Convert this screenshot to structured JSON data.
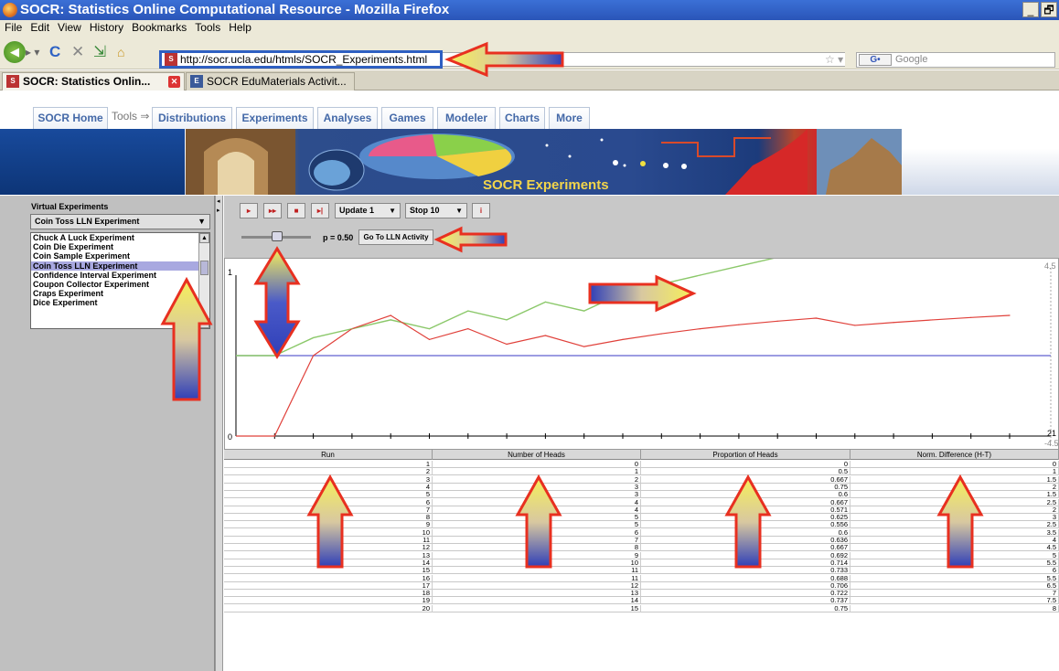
{
  "window": {
    "title": "SOCR: Statistics Online Computational Resource - Mozilla Firefox",
    "controls": [
      "_",
      "🗗"
    ]
  },
  "menu": [
    "File",
    "Edit",
    "View",
    "History",
    "Bookmarks",
    "Tools",
    "Help"
  ],
  "toolbar": {
    "url": "http://socr.ucla.edu/htmls/SOCR_Experiments.html",
    "search_engine": "G•",
    "search_placeholder": "Google"
  },
  "tabs": [
    {
      "label": "SOCR: Statistics Onlin..."
    },
    {
      "label": "SOCR EduMaterials Activit..."
    }
  ],
  "site_nav": {
    "home": "SOCR Home",
    "tools": "Tools ⇒",
    "items": [
      "Distributions",
      "Experiments",
      "Analyses",
      "Games",
      "Modeler",
      "Charts",
      "More"
    ]
  },
  "banner": {
    "title": "SOCR Experiments"
  },
  "left_panel": {
    "title": "Virtual Experiments",
    "selected": "Coin Toss LLN Experiment",
    "experiments": [
      "Chuck A Luck Experiment",
      "Coin Die Experiment",
      "Coin Sample Experiment",
      "Coin Toss LLN Experiment",
      "Confidence Interval Experiment",
      "Coupon Collector Experiment",
      "Craps Experiment",
      "Dice Experiment"
    ]
  },
  "controls": {
    "buttons": [
      "▸",
      "▸▸",
      "■",
      "▸|",
      "i"
    ],
    "update": "Update 1",
    "stop": "Stop 10",
    "p_label": "p = 0.50",
    "lln_button": "Go To LLN Activity",
    "p_value": 0.5
  },
  "graph": {
    "y_left_top": "1",
    "y_left_bottom": "0",
    "y_right_top": "4.5",
    "y_right_bottom": "-4.5",
    "x_right_label": "21"
  },
  "table": {
    "headers": [
      "Run",
      "Number of Heads",
      "Proportion of Heads",
      "Norm. Difference (H-T)"
    ],
    "rows": [
      [
        "1",
        "0",
        "0",
        "0"
      ],
      [
        "2",
        "1",
        "0.5",
        "1"
      ],
      [
        "3",
        "2",
        "0.667",
        "1.5"
      ],
      [
        "4",
        "3",
        "0.75",
        "2"
      ],
      [
        "5",
        "3",
        "0.6",
        "1.5"
      ],
      [
        "6",
        "4",
        "0.667",
        "2.5"
      ],
      [
        "7",
        "4",
        "0.571",
        "2"
      ],
      [
        "8",
        "5",
        "0.625",
        "3"
      ],
      [
        "9",
        "5",
        "0.556",
        "2.5"
      ],
      [
        "10",
        "6",
        "0.6",
        "3.5"
      ],
      [
        "11",
        "7",
        "0.636",
        "4"
      ],
      [
        "12",
        "8",
        "0.667",
        "4.5"
      ],
      [
        "13",
        "9",
        "0.692",
        "5"
      ],
      [
        "14",
        "10",
        "0.714",
        "5.5"
      ],
      [
        "15",
        "11",
        "0.733",
        "6"
      ],
      [
        "16",
        "11",
        "0.688",
        "5.5"
      ],
      [
        "17",
        "12",
        "0.706",
        "6.5"
      ],
      [
        "18",
        "13",
        "0.722",
        "7"
      ],
      [
        "19",
        "14",
        "0.737",
        "7.5"
      ],
      [
        "20",
        "15",
        "0.75",
        "8"
      ]
    ]
  },
  "chart_data": {
    "type": "line",
    "x": [
      1,
      2,
      3,
      4,
      5,
      6,
      7,
      8,
      9,
      10,
      11,
      12,
      13,
      14,
      15,
      16,
      17,
      18,
      19,
      20
    ],
    "series": [
      {
        "values": [
          0,
          0.5,
          0.667,
          0.75,
          0.6,
          0.667,
          0.571,
          0.625,
          0.556,
          0.6,
          0.636,
          0.667,
          0.692,
          0.714,
          0.733,
          0.688,
          0.706,
          0.722,
          0.737,
          0.75
        ],
        "color": "#e0403a"
      },
      {
        "values": [
          0,
          1,
          1.5,
          2,
          1.5,
          2.5,
          2,
          3,
          2.5,
          3.5,
          4,
          4.5,
          5,
          5.5,
          6,
          5.5,
          6.5,
          7,
          7.5,
          8
        ],
        "color": "#8bc86a"
      }
    ],
    "reference_line": {
      "value": 0.5,
      "color": "#6060d0"
    },
    "left_axis_range": [
      0,
      1
    ],
    "right_axis_range": [
      -4.5,
      4.5
    ]
  },
  "colors": {
    "accent_blue": "#2e5fc2",
    "arrow_red": "#e03020"
  }
}
